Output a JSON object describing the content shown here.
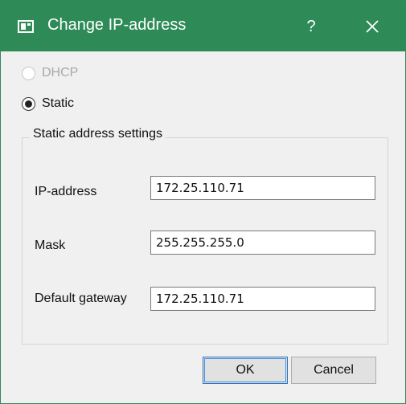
{
  "window": {
    "title": "Change IP-address",
    "help_label": "?",
    "titlebar_color": "#2e8b57"
  },
  "mode": {
    "dhcp_label": "DHCP",
    "dhcp_enabled": false,
    "static_label": "Static",
    "selected": "Static"
  },
  "group": {
    "title": "Static address settings",
    "fields": [
      {
        "label": "IP-address",
        "value": "172.25.110.71"
      },
      {
        "label": "Mask",
        "value": "255.255.255.0"
      },
      {
        "label": "Default gateway",
        "value": "172.25.110.71"
      }
    ]
  },
  "buttons": {
    "ok_label": "OK",
    "cancel_label": "Cancel"
  }
}
